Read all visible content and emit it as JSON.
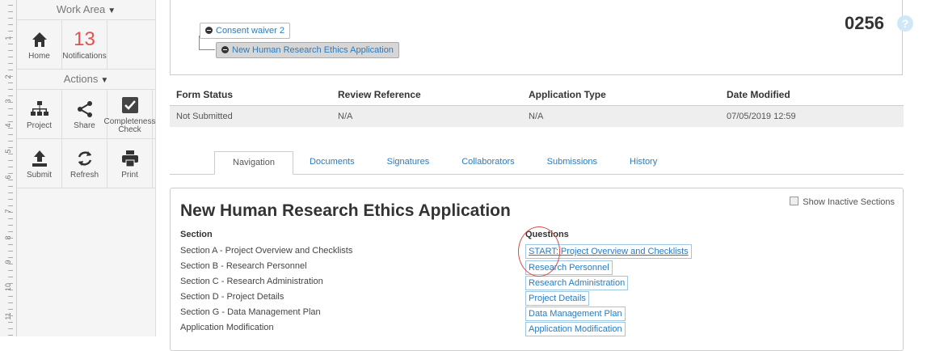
{
  "ruler": {
    "numbers": [
      "1",
      "2",
      "3",
      "4",
      "5",
      "6",
      "7",
      "8",
      "9",
      "10",
      "11"
    ]
  },
  "sidebar": {
    "work_area": {
      "title": "Work Area"
    },
    "home": {
      "label": "Home"
    },
    "notifications": {
      "count": "13",
      "label": "Notifications"
    },
    "actions": {
      "title": "Actions"
    },
    "tiles": [
      {
        "label": "Project",
        "icon": "sitemap-icon"
      },
      {
        "label": "Share",
        "icon": "share-icon"
      },
      {
        "label": "Completeness Check",
        "icon": "checkbox-icon"
      },
      {
        "label": "Submit",
        "icon": "upload-icon"
      },
      {
        "label": "Refresh",
        "icon": "refresh-icon"
      },
      {
        "label": "Print",
        "icon": "print-icon"
      }
    ]
  },
  "tree": {
    "parent": "Consent waiver 2",
    "child": "New Human Research Ethics Application",
    "app_id": "0256",
    "help": "?"
  },
  "status": {
    "headers": [
      "Form Status",
      "Review Reference",
      "Application Type",
      "Date Modified"
    ],
    "values": [
      "Not Submitted",
      "N/A",
      "N/A",
      "07/05/2019 12:59"
    ]
  },
  "tabs": [
    "Navigation",
    "Documents",
    "Signatures",
    "Collaborators",
    "Submissions",
    "History"
  ],
  "content": {
    "show_inactive": "Show Inactive Sections",
    "title": "New Human Research Ethics Application",
    "section_header": "Section",
    "questions_header": "Questions",
    "rows": [
      {
        "section": "Section A - Project Overview and Checklists",
        "question": "START: Project Overview and Checklists"
      },
      {
        "section": "Section B - Research Personnel",
        "question": "Research Personnel"
      },
      {
        "section": "Section C - Research Administration",
        "question": "Research Administration"
      },
      {
        "section": "Section D - Project Details",
        "question": "Project Details"
      },
      {
        "section": "Section G - Data Management Plan",
        "question": "Data Management Plan"
      },
      {
        "section": "Application Modification",
        "question": "Application Modification"
      }
    ]
  },
  "colors": {
    "link": "#2a7bbf",
    "notification": "#e05252",
    "annotation": "#d94a4a"
  }
}
